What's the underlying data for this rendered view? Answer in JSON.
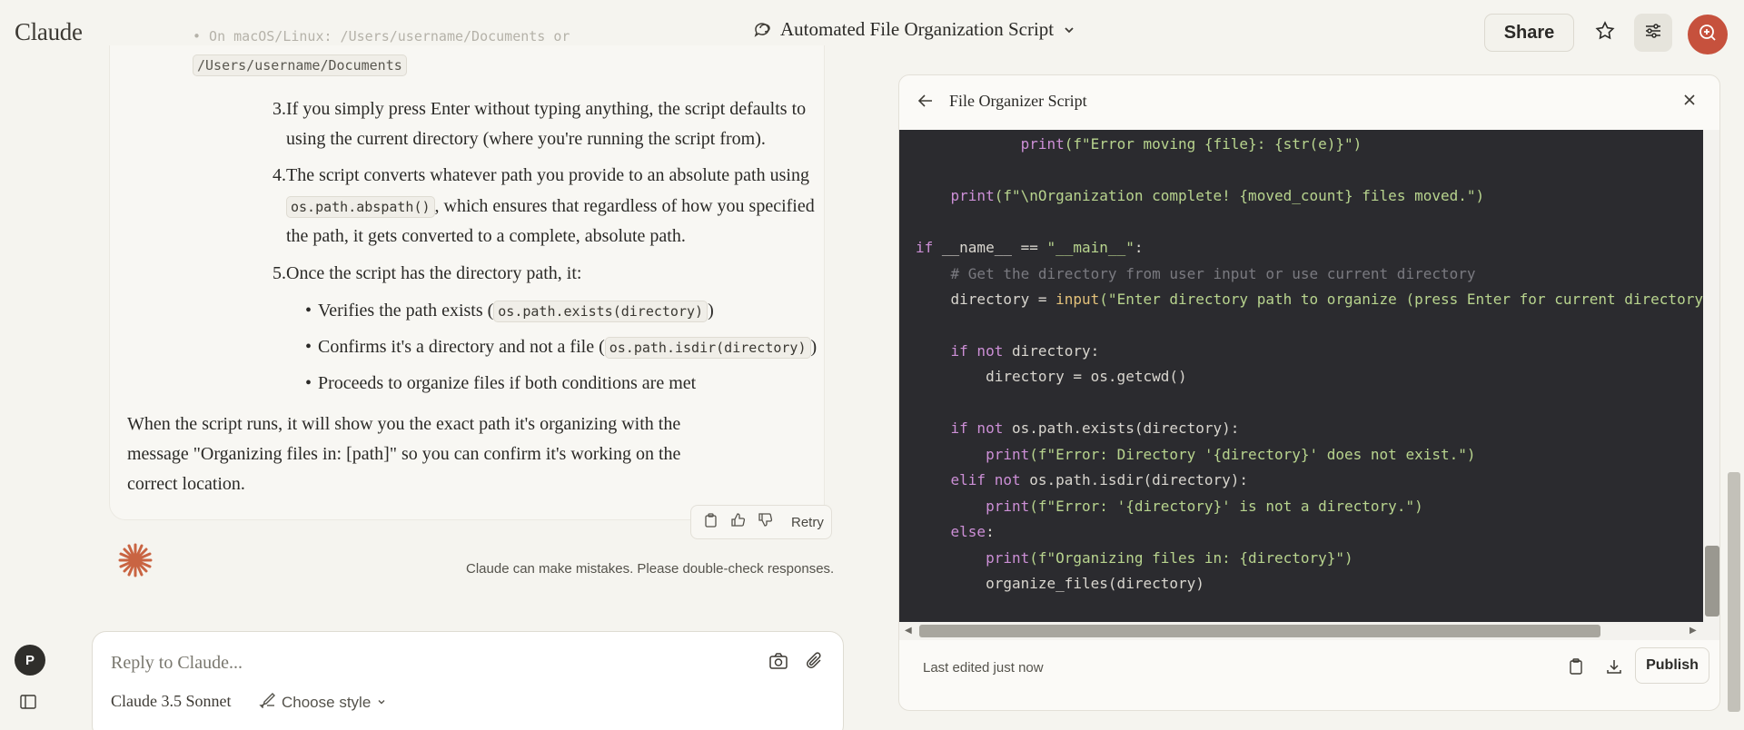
{
  "app": {
    "logo": "Claude",
    "chat_title": "Automated File Organization Script",
    "share_label": "Share"
  },
  "chat": {
    "faded_line": "• On macOS/Linux: /Users/username/Documents or",
    "faded_path": "/Users/username/Documents",
    "steps": [
      {
        "num": "3.",
        "lines": [
          "If you simply press Enter without typing anything, the script defaults to",
          "using the current directory (where you're running the script from)."
        ]
      },
      {
        "num": "4.",
        "line1_a": "The script converts whatever path you provide to an absolute path using",
        "code": "os.path.abspath()",
        "line2_b": ", which ensures that regardless of how you specified",
        "line3": "the path, it gets converted to a complete, absolute path."
      },
      {
        "num": "5.",
        "line1": "Once the script has the directory path, it:"
      }
    ],
    "bullets": [
      {
        "text": "Verifies the path exists (",
        "code": "os.path.exists(directory)",
        "tail": ")"
      },
      {
        "text": "Confirms it's a directory and not a file (",
        "code": "os.path.isdir(directory)",
        "tail": ")"
      },
      {
        "text": "Proceeds to organize files if both conditions are met"
      }
    ],
    "closing_lines": [
      "When the script runs, it will show you the exact path it's organizing with the",
      "message \"Organizing files in: [path]\" so you can confirm it's working on the",
      "correct location."
    ],
    "retry_label": "Retry",
    "disclaimer": "Claude can make mistakes. Please double-check responses."
  },
  "reply": {
    "placeholder": "Reply to Claude...",
    "model": "Claude 3.5 Sonnet",
    "style_label": "Choose style"
  },
  "user": {
    "initial": "P"
  },
  "artifact": {
    "title": "File Organizer Script",
    "last_edited": "Last edited just now",
    "publish_label": "Publish",
    "code": {
      "l1_indent": "            ",
      "l1_fn": "print",
      "l1_str": "(f\"Error moving {file}: {str(e)}\")",
      "l2_indent": "    ",
      "l2_fn": "print",
      "l2_str": "(f\"\\nOrganization complete! {moved_count} files moved.\")",
      "l3_kw": "if",
      "l3_rest": " __name__ == ",
      "l3_str": "\"__main__\"",
      "l3_end": ":",
      "l4_comment": "    # Get the directory from user input or use current directory",
      "l5_a": "    directory = ",
      "l5_fn": "input",
      "l5_str": "(\"Enter directory path to organize (press Enter for current directory): \")",
      "l6_indent": "    ",
      "l6_kw": "if not",
      "l6_rest": " directory:",
      "l7": "        directory = os.getcwd()",
      "l8_indent": "    ",
      "l8_kw": "if not",
      "l8_rest": " os.path.exists(directory):",
      "l9_indent": "        ",
      "l9_fn": "print",
      "l9_str": "(f\"Error: Directory '{directory}' does not exist.\")",
      "l10_indent": "    ",
      "l10_kw": "elif not",
      "l10_rest": " os.path.isdir(directory):",
      "l11_indent": "        ",
      "l11_fn": "print",
      "l11_str": "(f\"Error: '{directory}' is not a directory.\")",
      "l12_indent": "    ",
      "l12_kw": "else",
      "l12_rest": ":",
      "l13_indent": "        ",
      "l13_fn": "print",
      "l13_str": "(f\"Organizing files in: {directory}\")",
      "l14": "        organize_files(directory)"
    }
  },
  "colors": {
    "accent": "#c6513d",
    "background": "#f5f4ef",
    "code_bg": "#2b2b2f"
  },
  "icons": [
    "chat-bubble-icon",
    "chevron-down-icon",
    "star-icon",
    "sliders-icon",
    "avatar-icon",
    "copy-icon",
    "thumbs-up-icon",
    "thumbs-down-icon",
    "claude-spark-icon",
    "camera-icon",
    "paperclip-icon",
    "brush-icon",
    "sidebar-icon",
    "back-arrow-icon",
    "close-icon",
    "download-icon"
  ]
}
